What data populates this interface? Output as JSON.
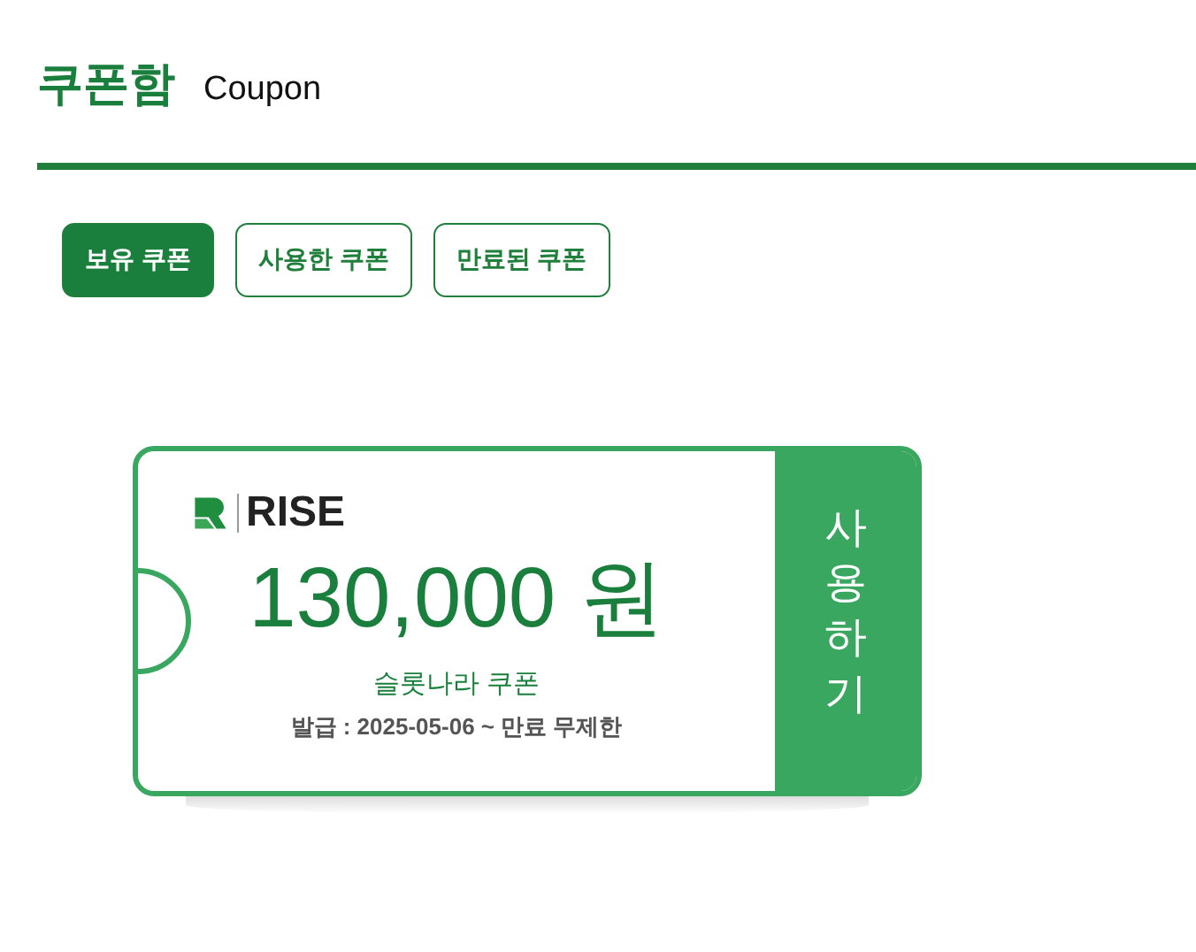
{
  "header": {
    "title": "쿠폰함",
    "subtitle": "Coupon"
  },
  "tabs": [
    {
      "label": "보유 쿠폰",
      "selected": true
    },
    {
      "label": "사용한 쿠폰",
      "selected": false
    },
    {
      "label": "만료된 쿠폰",
      "selected": false
    }
  ],
  "coupons": [
    {
      "brand": "RISE",
      "amount": "130,000 원",
      "name": "슬롯나라 쿠폰",
      "validity": "발급 : 2025-05-06 ~ 만료 무제한",
      "action": "사용하기"
    }
  ]
}
